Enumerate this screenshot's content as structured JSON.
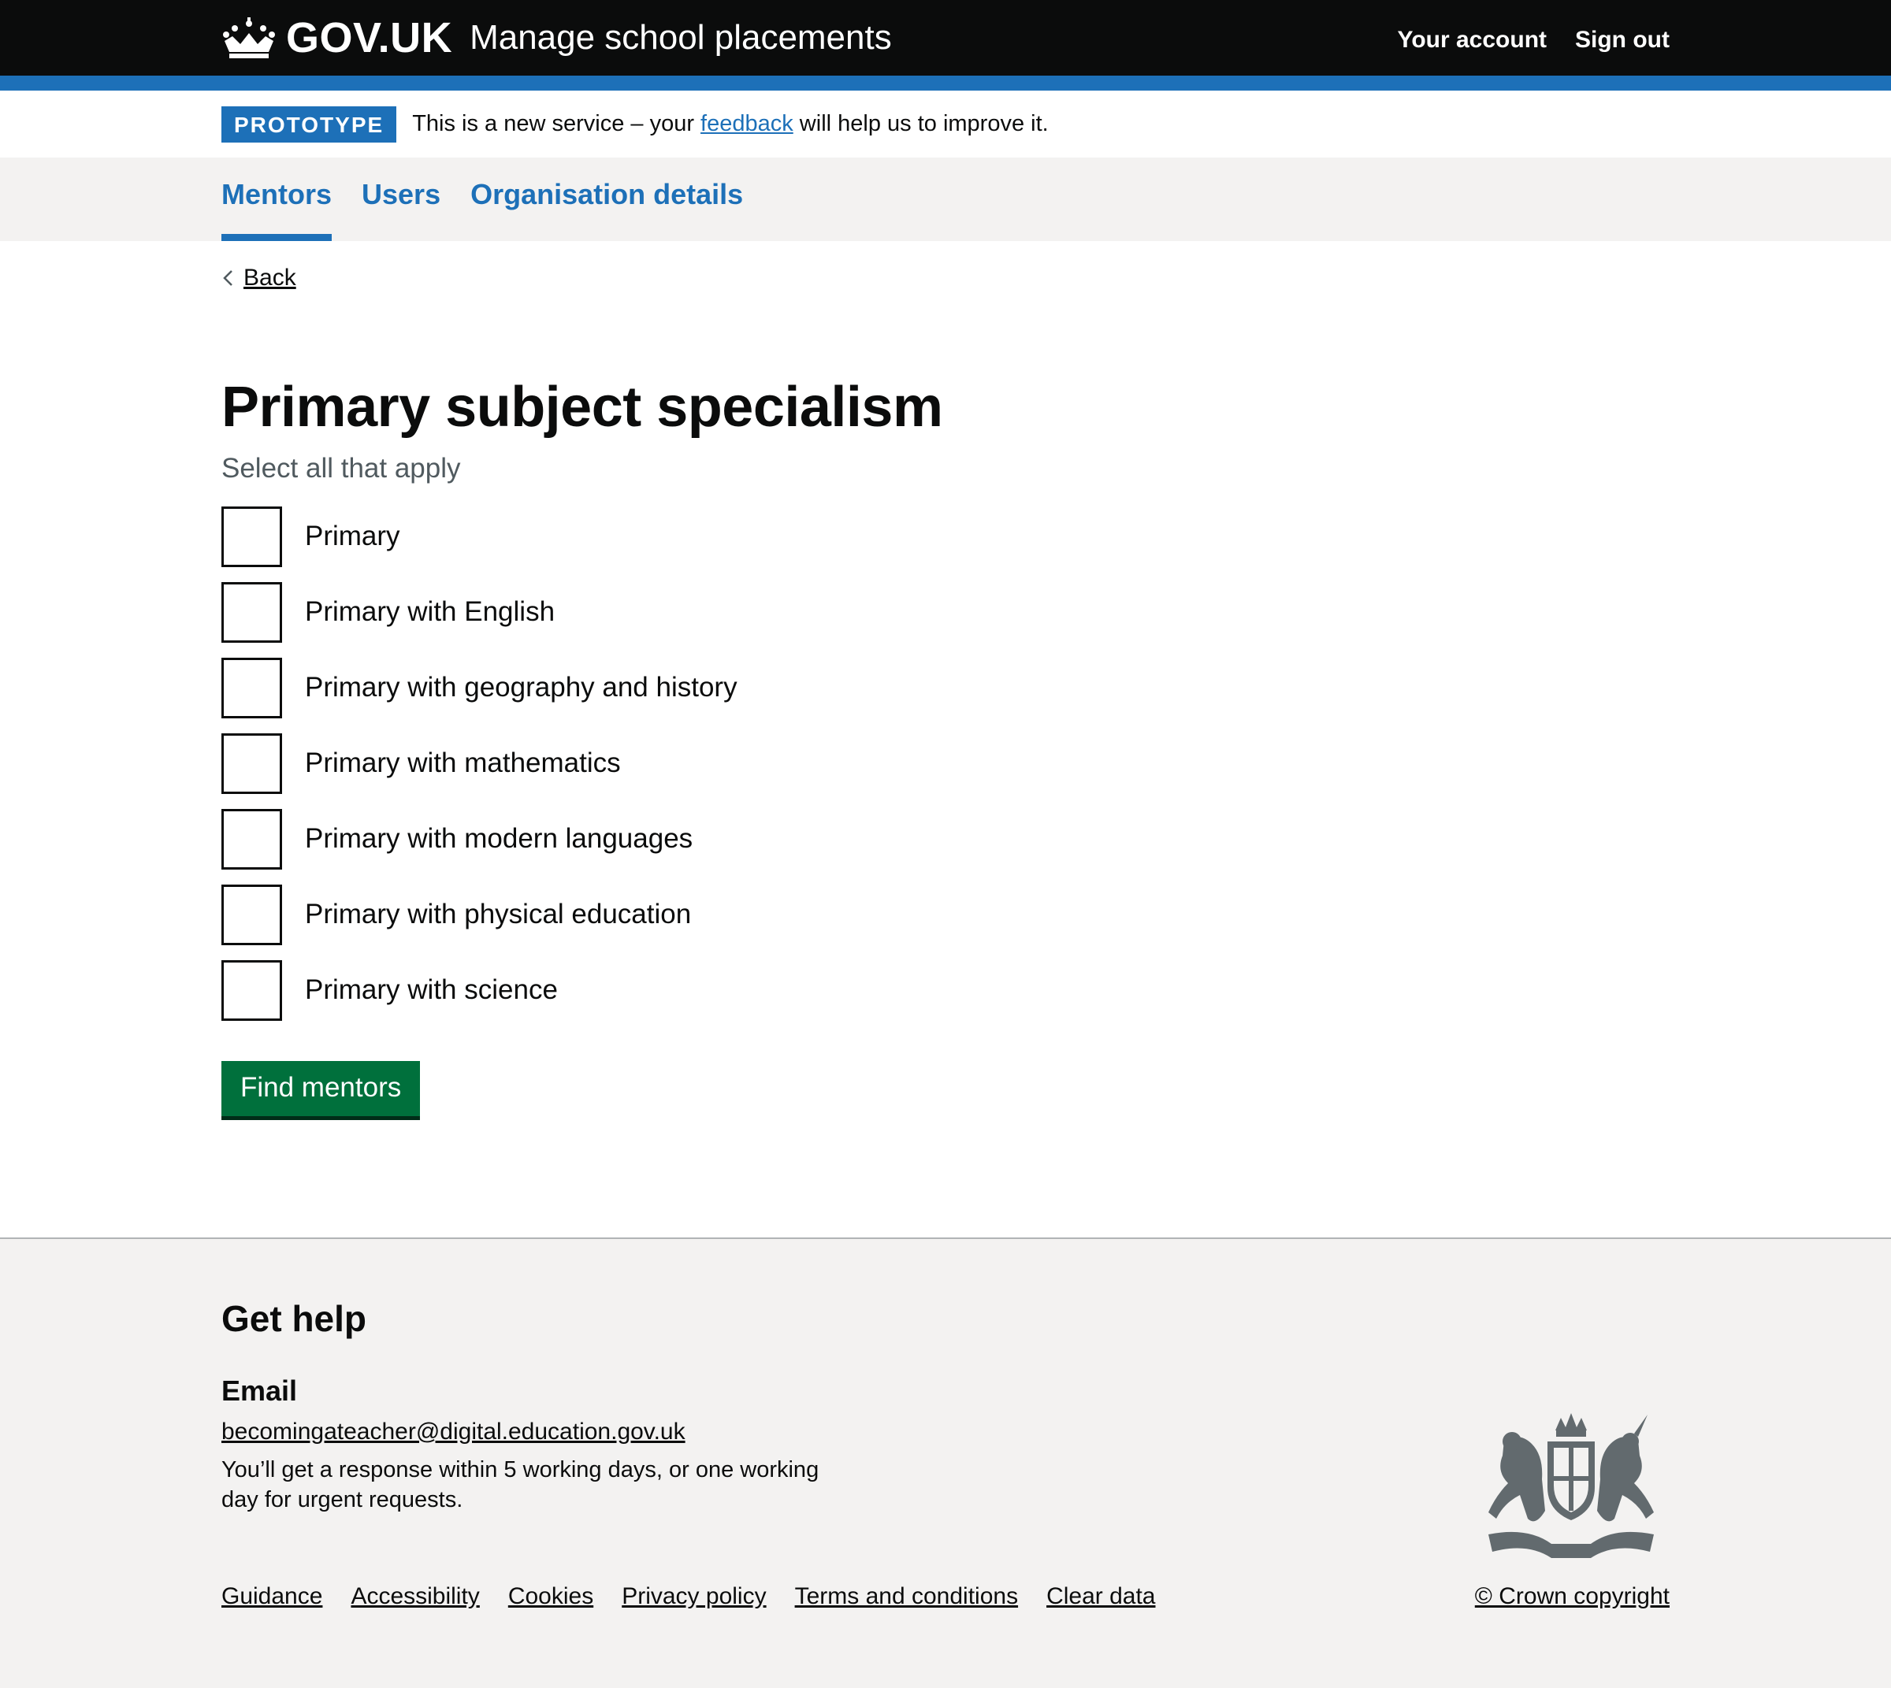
{
  "header": {
    "logo_text": "GOV.UK",
    "service_name": "Manage school placements",
    "nav": {
      "account": "Your account",
      "sign_out": "Sign out"
    }
  },
  "phase_banner": {
    "tag": "PROTOTYPE",
    "text_before": "This is a new service – your ",
    "link": "feedback",
    "text_after": " will help us to improve it."
  },
  "subnav": {
    "items": [
      {
        "label": "Mentors",
        "active": true
      },
      {
        "label": "Users",
        "active": false
      },
      {
        "label": "Organisation details",
        "active": false
      }
    ]
  },
  "main": {
    "back_label": "Back",
    "title": "Primary subject specialism",
    "hint": "Select all that apply",
    "options": [
      {
        "label": "Primary",
        "checked": false
      },
      {
        "label": "Primary with English",
        "checked": false
      },
      {
        "label": "Primary with geography and history",
        "checked": false
      },
      {
        "label": "Primary with mathematics",
        "checked": false
      },
      {
        "label": "Primary with modern languages",
        "checked": false
      },
      {
        "label": "Primary with physical education",
        "checked": false
      },
      {
        "label": "Primary with science",
        "checked": false
      }
    ],
    "submit_label": "Find mentors"
  },
  "footer": {
    "heading": "Get help",
    "email_heading": "Email",
    "email": "becomingateacher@digital.education.gov.uk",
    "response_text": "You’ll get a response within 5 working days, or one working day for urgent requests.",
    "links": [
      "Guidance",
      "Accessibility",
      "Cookies",
      "Privacy policy",
      "Terms and conditions",
      "Clear data"
    ],
    "copyright": "© Crown copyright"
  },
  "colors": {
    "header_bg": "#0b0c0c",
    "brand_blue": "#1d70b8",
    "button_green": "#00703c",
    "footer_bg": "#f3f2f1"
  }
}
